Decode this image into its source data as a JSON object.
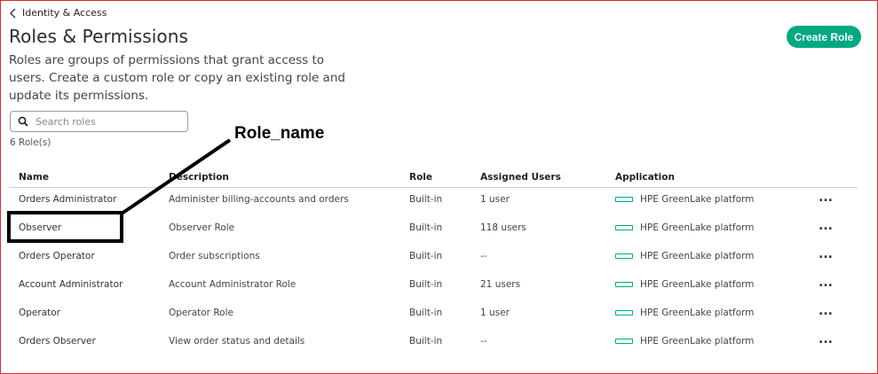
{
  "breadcrumb": {
    "label": "Identity & Access"
  },
  "header": {
    "title": "Roles & Permissions",
    "description": "Roles are groups of permissions that grant access to users. Create a custom role or copy an existing role and update its permissions.",
    "create_button": "Create Role"
  },
  "search": {
    "placeholder": "Search roles",
    "icon": "search-icon"
  },
  "role_count": "6 Role(s)",
  "annotation": {
    "label": "Role_name"
  },
  "table": {
    "columns": [
      "Name",
      "Description",
      "Role",
      "Assigned Users",
      "Application"
    ],
    "rows": [
      {
        "name": "Orders Administrator",
        "description": "Administer billing-accounts and orders",
        "role": "Built-in",
        "users": "1 user",
        "application": "HPE GreenLake platform"
      },
      {
        "name": "Observer",
        "description": "Observer Role",
        "role": "Built-in",
        "users": "118 users",
        "application": "HPE GreenLake platform"
      },
      {
        "name": "Orders Operator",
        "description": "Order subscriptions",
        "role": "Built-in",
        "users": "--",
        "application": "HPE GreenLake platform"
      },
      {
        "name": "Account Administrator",
        "description": "Account Administrator Role",
        "role": "Built-in",
        "users": "21 users",
        "application": "HPE GreenLake platform"
      },
      {
        "name": "Operator",
        "description": "Operator Role",
        "role": "Built-in",
        "users": "1 user",
        "application": "HPE GreenLake platform"
      },
      {
        "name": "Orders Observer",
        "description": "View order status and details",
        "role": "Built-in",
        "users": "--",
        "application": "HPE GreenLake platform"
      }
    ],
    "row_action": "..."
  },
  "colors": {
    "accent": "#01a982",
    "annotation": "#000000",
    "frame_border": "#d32f2f"
  }
}
